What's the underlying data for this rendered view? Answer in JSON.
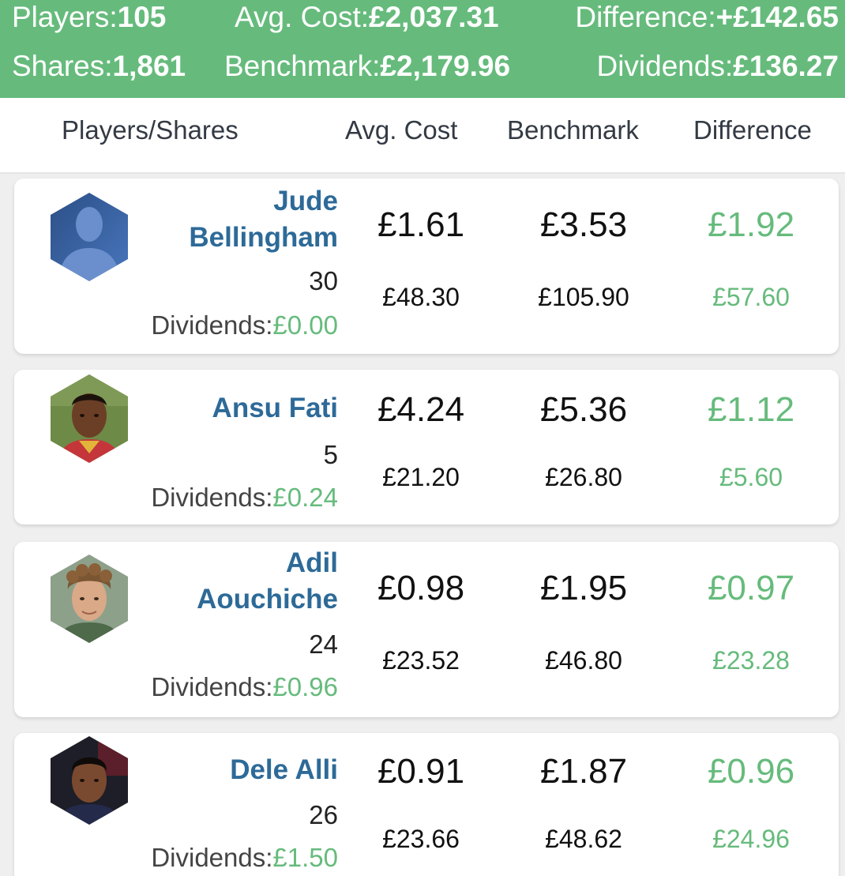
{
  "summary": {
    "players_label": "Players:",
    "players_value": "105",
    "avg_cost_label": "Avg. Cost:",
    "avg_cost_value": "£2,037.31",
    "difference_label": "Difference:",
    "difference_value": "+£142.65",
    "shares_label": "Shares:",
    "shares_value": "1,861",
    "benchmark_label": "Benchmark:",
    "benchmark_value": "£2,179.96",
    "dividends_label": "Dividends:",
    "dividends_value": "£136.27"
  },
  "columns": {
    "players_shares": "Players/Shares",
    "avg_cost": "Avg. Cost",
    "benchmark": "Benchmark",
    "difference": "Difference"
  },
  "dividends_label": "Dividends:",
  "colors": {
    "accent_green": "#66bb7c",
    "name_blue": "#2d6a98"
  },
  "players": [
    {
      "name_line1": "Jude",
      "name_line2": "Bellingham",
      "shares": "30",
      "dividends": "£0.00",
      "avg_cost": "£1.61",
      "avg_cost_total": "£48.30",
      "benchmark": "£3.53",
      "benchmark_total": "£105.90",
      "difference": "£1.92",
      "difference_total": "£57.60",
      "avatar_icon": "default-profile-silhouette-icon"
    },
    {
      "name_line1": "Ansu Fati",
      "name_line2": "",
      "shares": "5",
      "dividends": "£0.24",
      "avg_cost": "£4.24",
      "avg_cost_total": "£21.20",
      "benchmark": "£5.36",
      "benchmark_total": "£26.80",
      "difference": "£1.12",
      "difference_total": "£5.60",
      "avatar_icon": "player-photo"
    },
    {
      "name_line1": "Adil",
      "name_line2": "Aouchiche",
      "shares": "24",
      "dividends": "£0.96",
      "avg_cost": "£0.98",
      "avg_cost_total": "£23.52",
      "benchmark": "£1.95",
      "benchmark_total": "£46.80",
      "difference": "£0.97",
      "difference_total": "£23.28",
      "avatar_icon": "player-photo"
    },
    {
      "name_line1": "Dele Alli",
      "name_line2": "",
      "shares": "26",
      "dividends": "£1.50",
      "avg_cost": "£0.91",
      "avg_cost_total": "£23.66",
      "benchmark": "£1.87",
      "benchmark_total": "£48.62",
      "difference": "£0.96",
      "difference_total": "£24.96",
      "avatar_icon": "player-photo"
    }
  ]
}
